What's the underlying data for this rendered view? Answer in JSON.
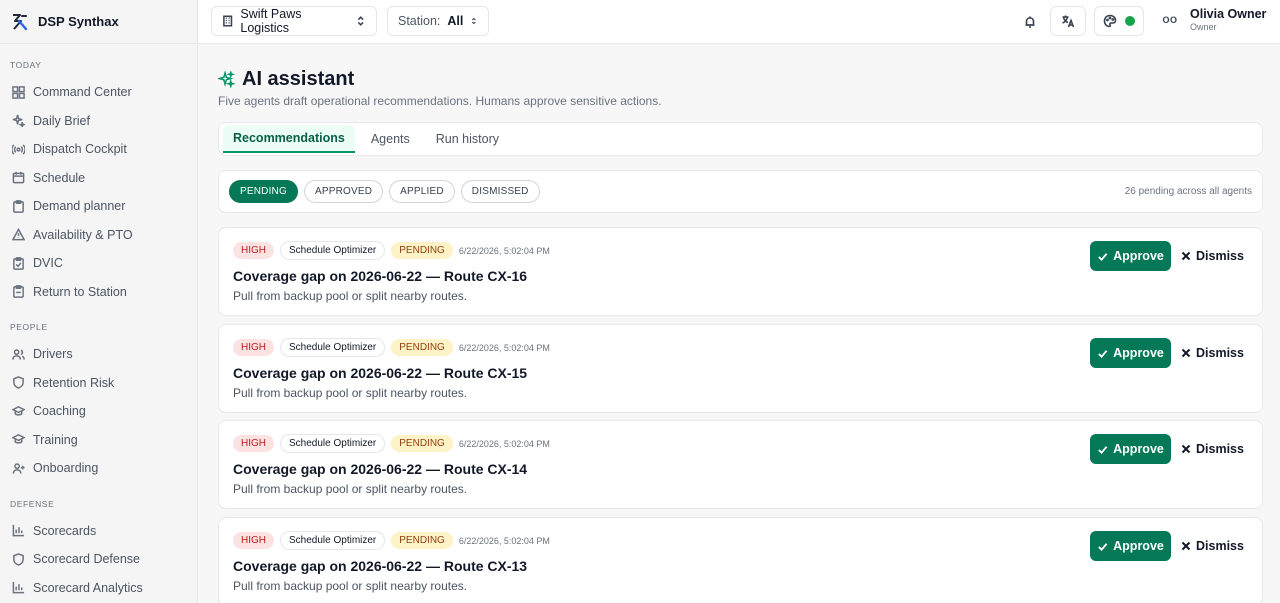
{
  "brand": {
    "name": "DSP Synthax"
  },
  "sidebar": {
    "sections": [
      {
        "label": "TODAY",
        "items": [
          {
            "label": "Command Center",
            "icon": "grid-icon"
          },
          {
            "label": "Daily Brief",
            "icon": "sparkles-icon"
          },
          {
            "label": "Dispatch Cockpit",
            "icon": "radio-icon"
          },
          {
            "label": "Schedule",
            "icon": "calendar-icon"
          },
          {
            "label": "Demand planner",
            "icon": "clipboard-icon"
          },
          {
            "label": "Availability & PTO",
            "icon": "alert-triangle-icon"
          },
          {
            "label": "DVIC",
            "icon": "clipboard-check-icon"
          },
          {
            "label": "Return to Station",
            "icon": "clipboard-return-icon"
          }
        ]
      },
      {
        "label": "PEOPLE",
        "items": [
          {
            "label": "Drivers",
            "icon": "users-icon"
          },
          {
            "label": "Retention Risk",
            "icon": "shield-icon"
          },
          {
            "label": "Coaching",
            "icon": "graduation-cap-icon"
          },
          {
            "label": "Training",
            "icon": "graduation-cap-icon"
          },
          {
            "label": "Onboarding",
            "icon": "user-plus-icon"
          }
        ]
      },
      {
        "label": "DEFENSE",
        "items": [
          {
            "label": "Scorecards",
            "icon": "bar-chart-icon"
          },
          {
            "label": "Scorecard Defense",
            "icon": "shield-icon"
          },
          {
            "label": "Scorecard Analytics",
            "icon": "bar-chart-icon"
          }
        ]
      }
    ]
  },
  "header": {
    "company": "Swift Paws Logistics",
    "station_label": "Station:",
    "station_value": "All",
    "user_initials": "OO",
    "user_name": "Olivia Owner",
    "user_role": "Owner"
  },
  "page": {
    "title": "AI assistant",
    "subtitle": "Five agents draft operational recommendations. Humans approve sensitive actions."
  },
  "tabs": [
    {
      "label": "Recommendations",
      "active": true
    },
    {
      "label": "Agents",
      "active": false
    },
    {
      "label": "Run history",
      "active": false
    }
  ],
  "filters": {
    "chips": [
      {
        "label": "PENDING",
        "active": true
      },
      {
        "label": "APPROVED",
        "active": false
      },
      {
        "label": "APPLIED",
        "active": false
      },
      {
        "label": "DISMISSED",
        "active": false
      }
    ],
    "count_text": "26 pending across all agents"
  },
  "actions": {
    "approve": "Approve",
    "dismiss": "Dismiss"
  },
  "recommendations": [
    {
      "priority": "HIGH",
      "agent": "Schedule Optimizer",
      "status": "PENDING",
      "time": "6/22/2026, 5:02:04 PM",
      "title": "Coverage gap on 2026-06-22 — Route CX-16",
      "desc": "Pull from backup pool or split nearby routes."
    },
    {
      "priority": "HIGH",
      "agent": "Schedule Optimizer",
      "status": "PENDING",
      "time": "6/22/2026, 5:02:04 PM",
      "title": "Coverage gap on 2026-06-22 — Route CX-15",
      "desc": "Pull from backup pool or split nearby routes."
    },
    {
      "priority": "HIGH",
      "agent": "Schedule Optimizer",
      "status": "PENDING",
      "time": "6/22/2026, 5:02:04 PM",
      "title": "Coverage gap on 2026-06-22 — Route CX-14",
      "desc": "Pull from backup pool or split nearby routes."
    },
    {
      "priority": "HIGH",
      "agent": "Schedule Optimizer",
      "status": "PENDING",
      "time": "6/22/2026, 5:02:04 PM",
      "title": "Coverage gap on 2026-06-22 — Route CX-13",
      "desc": "Pull from backup pool or split nearby routes."
    }
  ],
  "colors": {
    "accent": "#047857",
    "high_bg": "#fde2e2",
    "pending_bg": "#fef3c7",
    "status_online": "#16a34a"
  }
}
